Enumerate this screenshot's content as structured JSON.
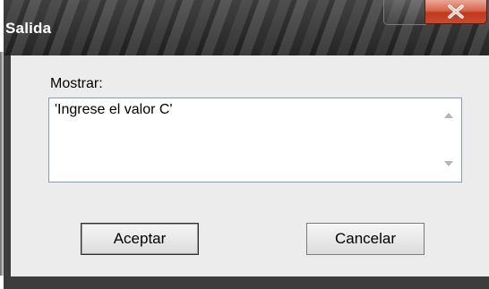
{
  "dialog": {
    "title": "Salida",
    "prompt_label": "Mostrar:",
    "message": "'Ingrese el valor C'",
    "ok_label": "Aceptar",
    "cancel_label": "Cancelar"
  },
  "icons": {
    "close": "close-icon",
    "scroll_up": "scroll-up-arrow-icon",
    "scroll_down": "scroll-down-arrow-icon"
  },
  "colors": {
    "titlebar": "#2f2f2f",
    "client_background": "#ececec",
    "close_button": "#c94a2f",
    "textbox_border": "#7f9db9"
  }
}
